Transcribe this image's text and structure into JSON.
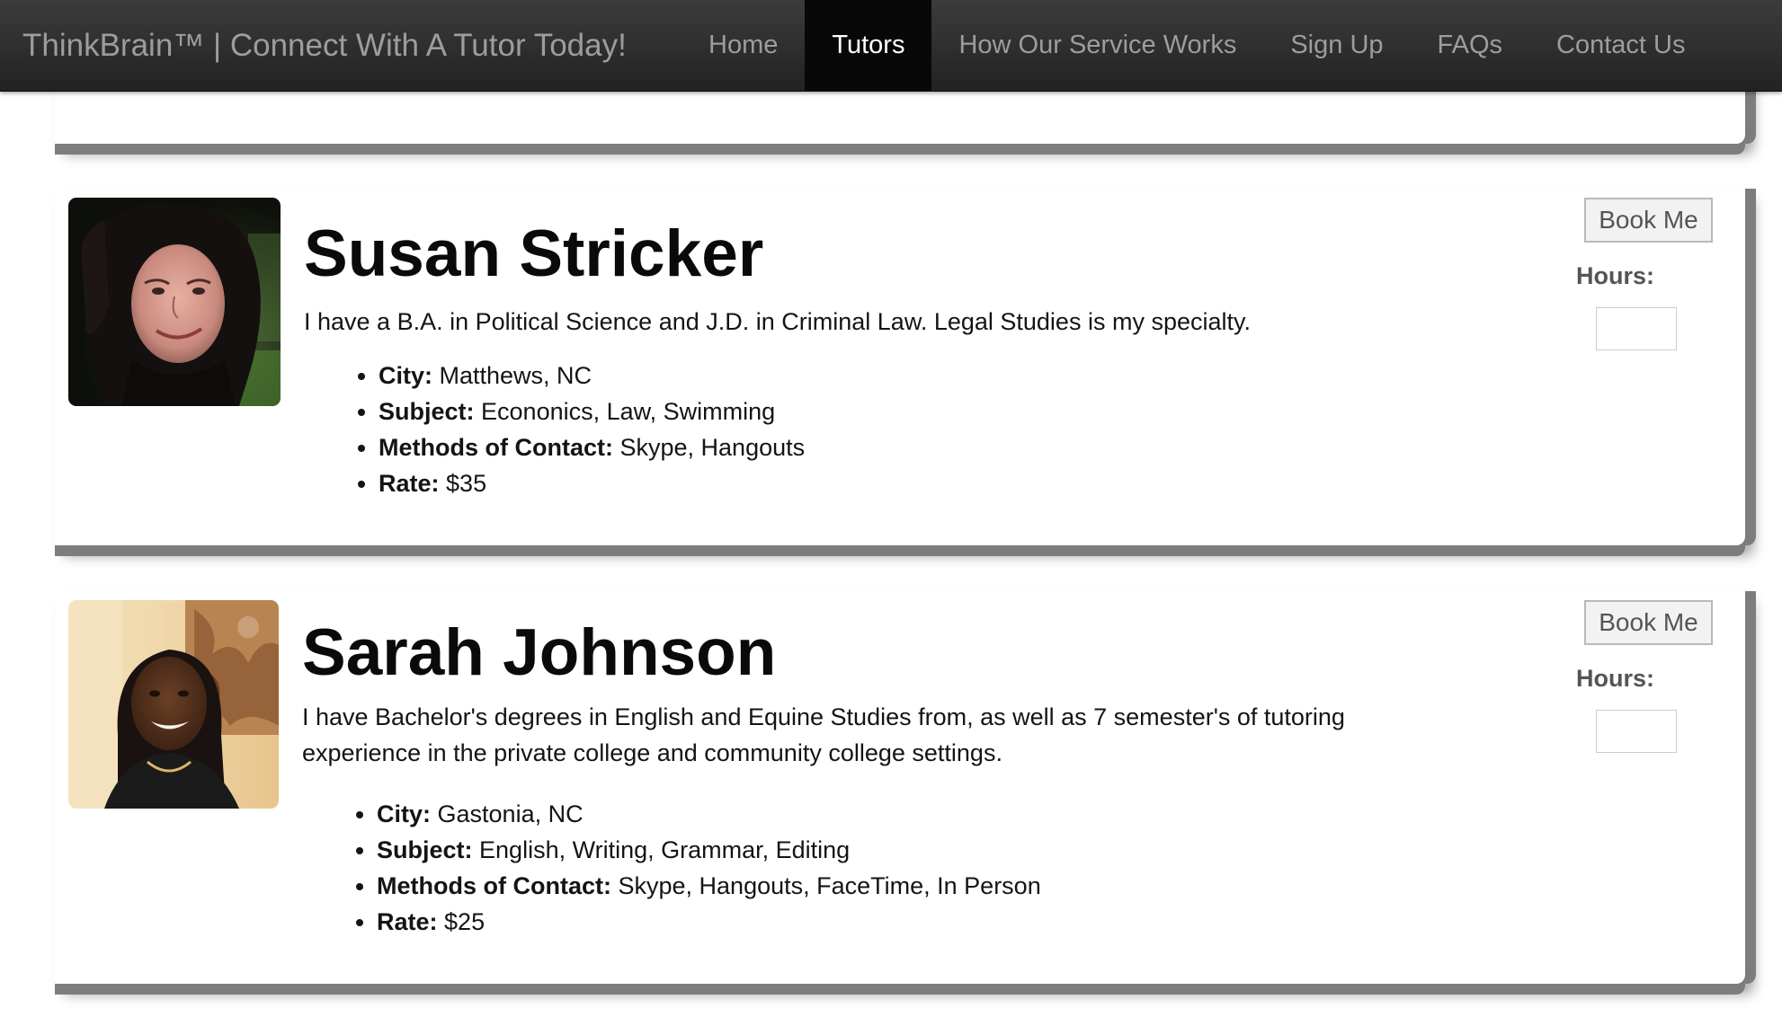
{
  "nav": {
    "brand": "ThinkBrain™ | Connect With A Tutor Today!",
    "links": [
      {
        "label": "Home",
        "active": false
      },
      {
        "label": "Tutors",
        "active": true
      },
      {
        "label": "How Our Service Works",
        "active": false
      },
      {
        "label": "Sign Up",
        "active": false
      },
      {
        "label": "FAQs",
        "active": false
      },
      {
        "label": "Contact Us",
        "active": false
      }
    ]
  },
  "tutors": [
    {
      "name": "Susan Stricker",
      "bio": "I have a B.A. in Political Science and J.D. in Criminal Law. Legal Studies is my specialty.",
      "city_label": "City:",
      "city": "Matthews, NC",
      "subject_label": "Subject:",
      "subject": "Econonics, Law, Swimming",
      "contact_label": "Methods of Contact:",
      "contact": "Skype, Hangouts",
      "rate_label": "Rate:",
      "rate": "$35",
      "book_label": "Book Me",
      "hours_label": "Hours:",
      "hours_value": ""
    },
    {
      "name": "Sarah Johnson",
      "bio": "I have Bachelor's degrees in English and Equine Studies from, as well as 7 semester's of tutoring experience in the private college and community college settings.",
      "city_label": "City:",
      "city": "Gastonia, NC",
      "subject_label": "Subject:",
      "subject": "English, Writing, Grammar, Editing",
      "contact_label": "Methods of Contact:",
      "contact": "Skype, Hangouts, FaceTime, In Person",
      "rate_label": "Rate:",
      "rate": "$25",
      "book_label": "Book Me",
      "hours_label": "Hours:",
      "hours_value": ""
    }
  ]
}
